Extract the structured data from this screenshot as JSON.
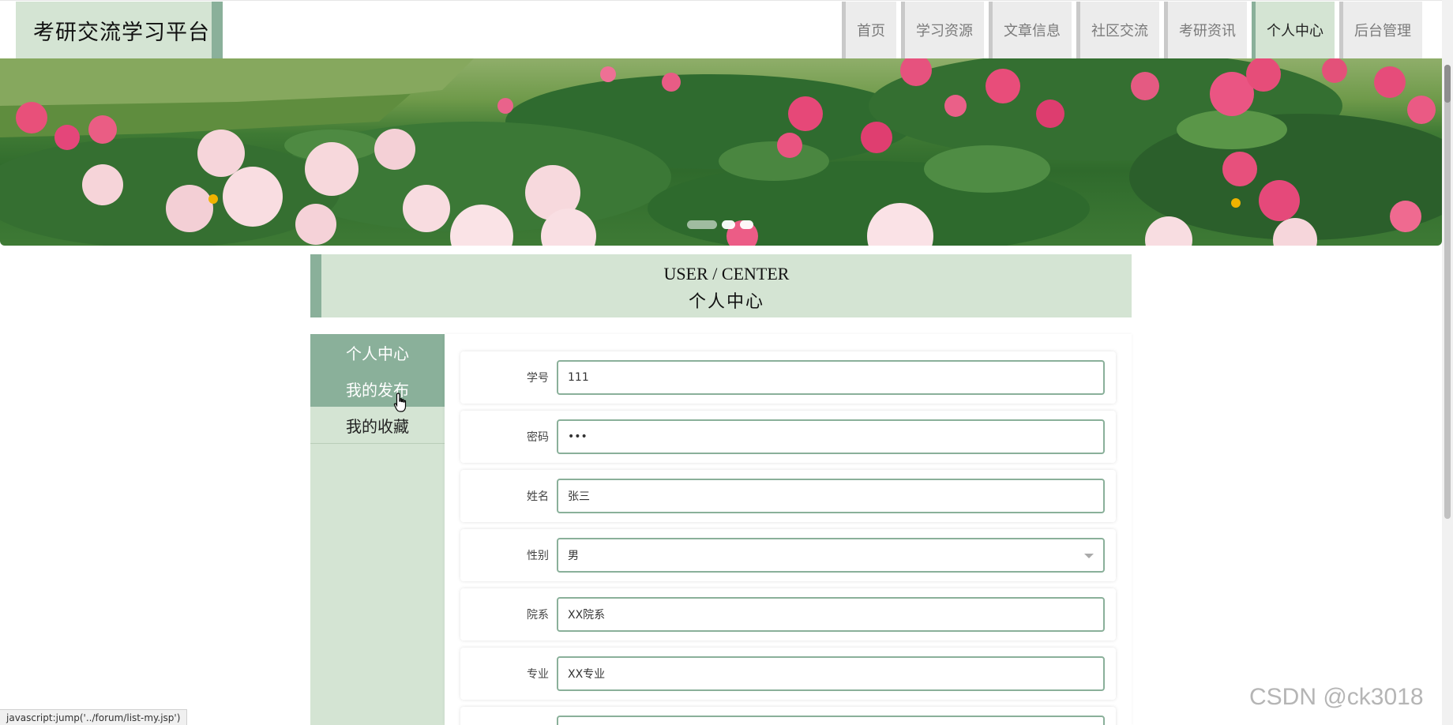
{
  "header": {
    "logo": "考研交流学习平台",
    "nav": [
      {
        "label": "首页",
        "active": false
      },
      {
        "label": "学习资源",
        "active": false
      },
      {
        "label": "文章信息",
        "active": false
      },
      {
        "label": "社区交流",
        "active": false
      },
      {
        "label": "考研资讯",
        "active": false
      },
      {
        "label": "个人中心",
        "active": true
      },
      {
        "label": "后台管理",
        "active": false
      }
    ]
  },
  "banner": {
    "active_slide": 1,
    "slide_count": 3
  },
  "title": {
    "en": "USER / CENTER",
    "cn": "个人中心"
  },
  "sidebar": {
    "items": [
      {
        "label": "个人中心"
      },
      {
        "label": "我的发布"
      },
      {
        "label": "我的收藏"
      }
    ]
  },
  "form": {
    "fields": [
      {
        "label": "学号",
        "value": "111",
        "type": "text"
      },
      {
        "label": "密码",
        "value": "•••",
        "type": "password"
      },
      {
        "label": "姓名",
        "value": "张三",
        "type": "text"
      },
      {
        "label": "性别",
        "value": "男",
        "type": "select"
      },
      {
        "label": "院系",
        "value": "XX院系",
        "type": "text"
      },
      {
        "label": "专业",
        "value": "XX专业",
        "type": "text"
      }
    ]
  },
  "status_bar": {
    "text": "javascript:jump('../forum/list-my.jsp')"
  },
  "watermark": "CSDN @ck3018",
  "colors": {
    "accent": "#8ab09a",
    "light_green": "#d4e4d3",
    "nav_inactive": "#ececec"
  }
}
